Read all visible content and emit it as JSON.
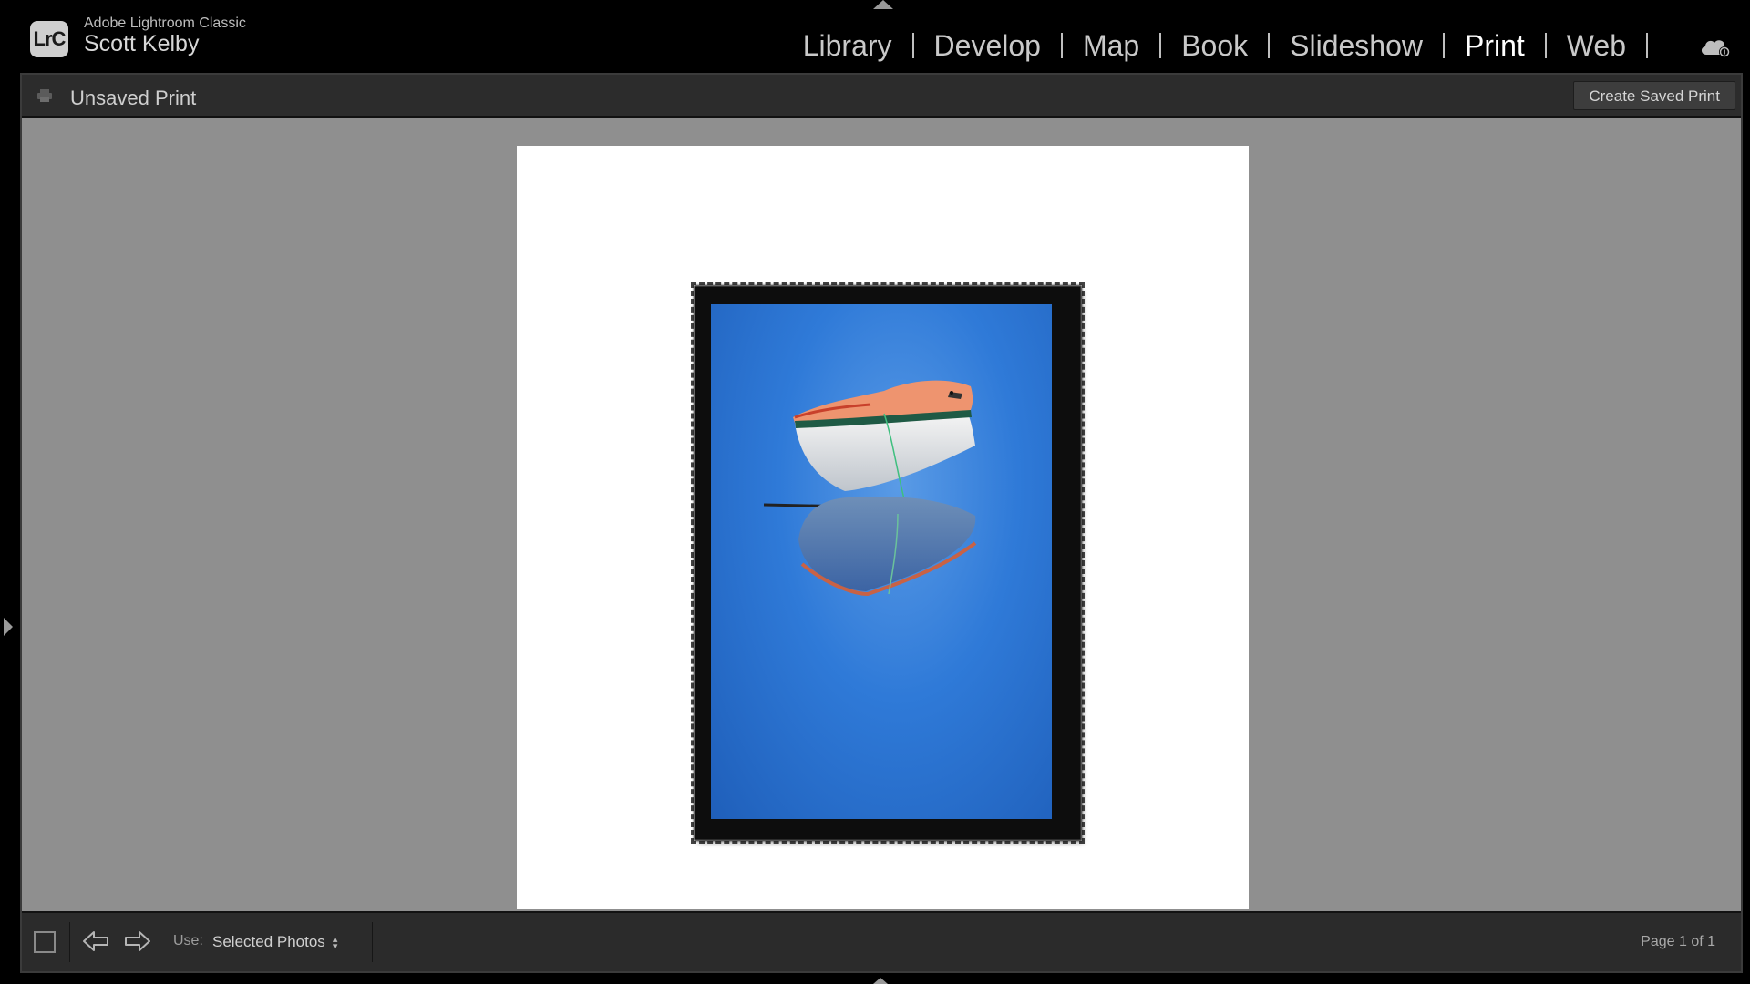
{
  "app": {
    "logo_text": "LrC",
    "app_name": "Adobe Lightroom Classic",
    "user_name": "Scott Kelby"
  },
  "modules": [
    {
      "label": "Library",
      "active": false
    },
    {
      "label": "Develop",
      "active": false
    },
    {
      "label": "Map",
      "active": false
    },
    {
      "label": "Book",
      "active": false
    },
    {
      "label": "Slideshow",
      "active": false
    },
    {
      "label": "Print",
      "active": true
    },
    {
      "label": "Web",
      "active": false
    }
  ],
  "header": {
    "title": "Unsaved Print",
    "create_button": "Create Saved Print"
  },
  "canvas": {
    "photo_icon": "rowboat-photo"
  },
  "toolbar": {
    "use_label": "Use:",
    "use_value": "Selected Photos",
    "page_info": "Page 1 of 1"
  },
  "icons": {
    "cloud": "cloud-sync-icon",
    "print": "printer-icon",
    "prev": "previous-page-icon",
    "next": "next-page-icon"
  },
  "colors": {
    "background": "#000000",
    "canvas": "#8f8f8f",
    "panel": "#2b2b2b",
    "active_module": "#ffffff"
  }
}
